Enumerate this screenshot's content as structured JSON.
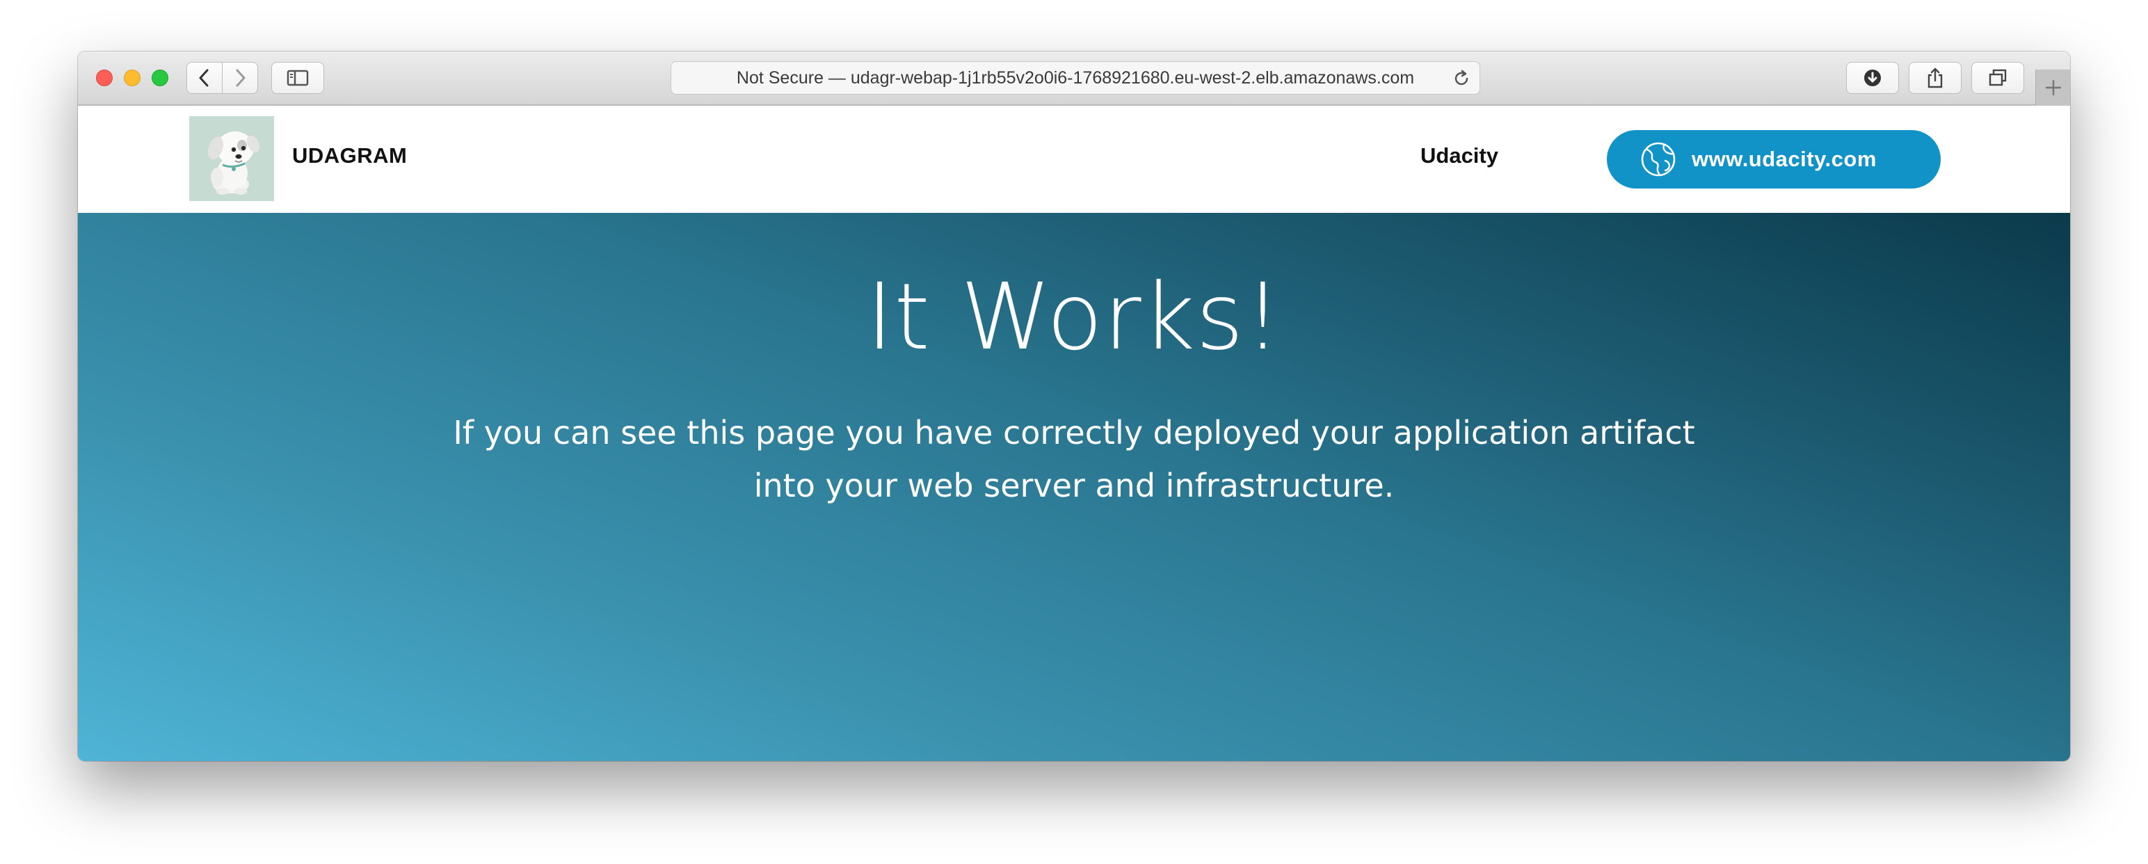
{
  "browser": {
    "address_bar": {
      "text": "Not Secure — udagr-webap-1j1rb55v2o0i6-1768921680.eu-west-2.elb.amazonaws.com"
    },
    "icons": {
      "back": "chevron-left-icon",
      "forward": "chevron-right-icon",
      "sidebar": "sidebar-icon",
      "reload": "reload-icon",
      "downloads": "download-icon",
      "share": "share-icon",
      "tabs": "tab-overview-icon",
      "new_tab": "plus-icon"
    }
  },
  "site": {
    "brand": "UDAGRAM",
    "logo_icon": "dog-logo",
    "nav_link": "Udacity",
    "cta_label": "www.udacity.com",
    "cta_icon": "globe-icon",
    "colors": {
      "cta": "#1193c7",
      "hero_light": "#4fb4d6",
      "hero_dark": "#0b3a4b"
    }
  },
  "hero": {
    "title": "It Works!",
    "subtitle": "If you can see this page you have correctly deployed your application artifact into your web server and infrastructure."
  }
}
